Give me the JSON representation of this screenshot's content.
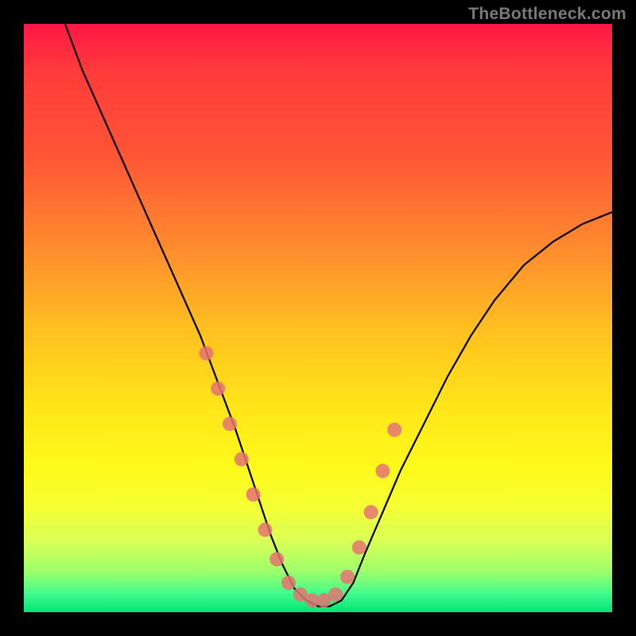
{
  "watermark": {
    "text": "TheBottleneck.com"
  },
  "chart_data": {
    "type": "line",
    "title": "",
    "xlabel": "",
    "ylabel": "",
    "xlim": [
      0,
      100
    ],
    "ylim": [
      0,
      100
    ],
    "series": [
      {
        "name": "bottleneck-curve",
        "x": [
          7,
          10,
          14,
          18,
          22,
          26,
          30,
          33,
          36,
          38,
          40,
          42,
          44,
          46,
          48,
          50,
          52,
          54,
          56,
          58,
          61,
          64,
          68,
          72,
          76,
          80,
          85,
          90,
          95,
          100
        ],
        "y": [
          100,
          92,
          83,
          74,
          65,
          56,
          47,
          39,
          31,
          25,
          19,
          13,
          8,
          4,
          2,
          1,
          1,
          2,
          5,
          10,
          17,
          24,
          32,
          40,
          47,
          53,
          59,
          63,
          66,
          68
        ]
      }
    ],
    "markers": {
      "name": "highlighted-points",
      "color": "#e57373",
      "x": [
        31,
        33,
        35,
        37,
        39,
        41,
        43,
        45,
        47,
        49,
        51,
        53,
        55,
        57,
        59,
        61,
        63
      ],
      "y": [
        44,
        38,
        32,
        26,
        20,
        14,
        9,
        5,
        3,
        2,
        2,
        3,
        6,
        11,
        17,
        24,
        31
      ]
    }
  }
}
